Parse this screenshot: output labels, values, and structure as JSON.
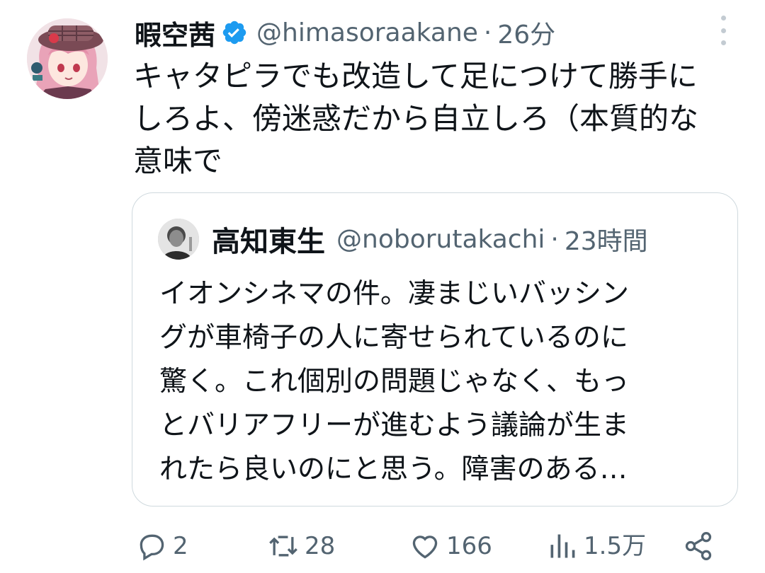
{
  "tweet": {
    "author_name": "暇空茜",
    "author_handle": "@himasoraakane",
    "separator": "·",
    "time": "26分",
    "text": "キャタピラでも改造して足につけて勝手に\nしろよ、傍迷惑だから自立しろ（本質的な\n意味で"
  },
  "quoted": {
    "author_name": "高知東生",
    "author_handle": "@noborutakachi",
    "separator": "·",
    "time": "23時間",
    "text": "イオンシネマの件。凄まじいバッシン\nグが車椅子の人に寄せられているのに\n驚く。これ個別の問題じゃなく、もっ\nとバリアフリーが進むよう議論が生ま\nれたら良いのにと思う。障害のある…"
  },
  "actions": {
    "replies": "2",
    "retweets": "28",
    "likes": "166",
    "views": "1.5万"
  },
  "icons": {
    "verified": "verified-badge-icon",
    "more": "more-vertical-icon",
    "reply": "reply-icon",
    "retweet": "retweet-icon",
    "like": "heart-icon",
    "views": "views-icon",
    "share": "share-icon"
  },
  "colors": {
    "verified": "#1d9bf0",
    "text": "#0f1419",
    "secondary": "#536471",
    "border": "#cfd9de"
  }
}
